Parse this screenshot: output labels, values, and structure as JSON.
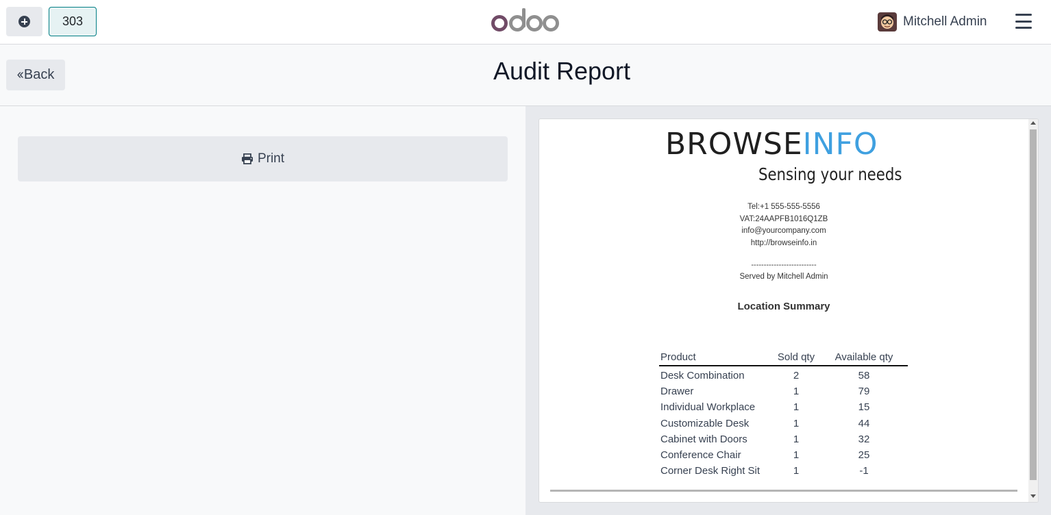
{
  "navbar": {
    "order_number": "303",
    "brand": "odoo",
    "user_name": "Mitchell Admin"
  },
  "header": {
    "back_label": "Back",
    "title": "Audit Report"
  },
  "actions": {
    "print_label": "Print"
  },
  "receipt": {
    "logo": {
      "brand_dark": "BROWSE",
      "brand_blue": "INFO",
      "tagline": "Sensing your needs"
    },
    "contact": {
      "tel": "Tel:+1 555-555-5556",
      "vat": "VAT:24AAPFB1016Q1ZB",
      "email": "info@yourcompany.com",
      "website": "http://browseinfo.in"
    },
    "separator": "--------------------------",
    "served_by": "Served by Mitchell Admin",
    "section_title": "Location Summary",
    "table": {
      "headers": [
        "Product",
        "Sold qty",
        "Available qty"
      ],
      "rows": [
        {
          "product": "Desk Combination",
          "sold": "2",
          "available": "58"
        },
        {
          "product": "Drawer",
          "sold": "1",
          "available": "79"
        },
        {
          "product": "Individual Workplace",
          "sold": "1",
          "available": "15"
        },
        {
          "product": "Customizable Desk",
          "sold": "1",
          "available": "44"
        },
        {
          "product": "Cabinet with Doors",
          "sold": "1",
          "available": "32"
        },
        {
          "product": "Conference Chair",
          "sold": "1",
          "available": "25"
        },
        {
          "product": "Corner Desk Right Sit",
          "sold": "1",
          "available": "-1"
        }
      ]
    }
  },
  "icons": [
    "plus-circle-icon",
    "hamburger-menu-icon",
    "double-chevron-left-icon",
    "printer-icon"
  ],
  "colors": {
    "accent": "#017e84",
    "odoo_purple": "#714b67",
    "odoo_grey": "#8f8f8f",
    "brand_blue": "#3fa0e0"
  }
}
